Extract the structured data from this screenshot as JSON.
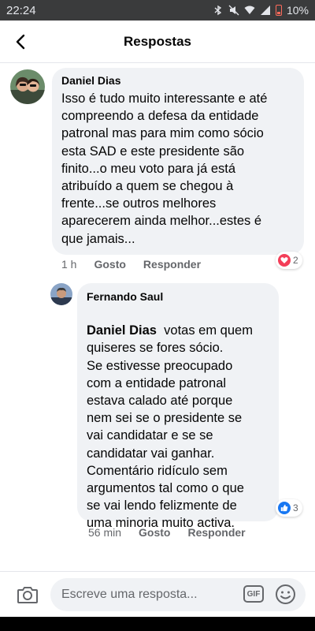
{
  "status_bar": {
    "time": "22:24",
    "battery": "10%"
  },
  "header": {
    "title": "Respostas"
  },
  "comments": [
    {
      "author": "Daniel Dias",
      "text": "Isso é tudo muito interessante e até\ncompreendo a defesa da entidade\npatronal mas para mim como sócio\nesta SAD e este presidente são\nfinito...o meu voto para já está\natribuído a quem se chegou à\nfrente...se outros melhores\naparecerem ainda melhor...estes é\nque jamais...",
      "time": "1 h",
      "like_label": "Gosto",
      "reply_label": "Responder",
      "reaction_count": "2",
      "reaction_icon": "heart-icon",
      "reaction_color": "#f33e58"
    },
    {
      "author": "Fernando Saul",
      "mention": "Daniel Dias",
      "text_after_mention": "  votas em quem",
      "text": "quiseres se fores sócio.\nSe estivesse preocupado\ncom a entidade patronal\nestava calado até porque\nnem sei se o presidente se\nvai candidatar e se se\ncandidatar vai ganhar.\nComentário ridículo sem\nargumentos tal como o que\nse vai lendo  felizmente de\numa minoria muito activa.",
      "time": "56 min",
      "like_label": "Gosto",
      "reply_label": "Responder",
      "reaction_count": "3",
      "reaction_icon": "like-icon",
      "reaction_color": "#1877f2"
    }
  ],
  "composer": {
    "placeholder": "Escreve uma resposta...",
    "gif_label": "GIF"
  }
}
